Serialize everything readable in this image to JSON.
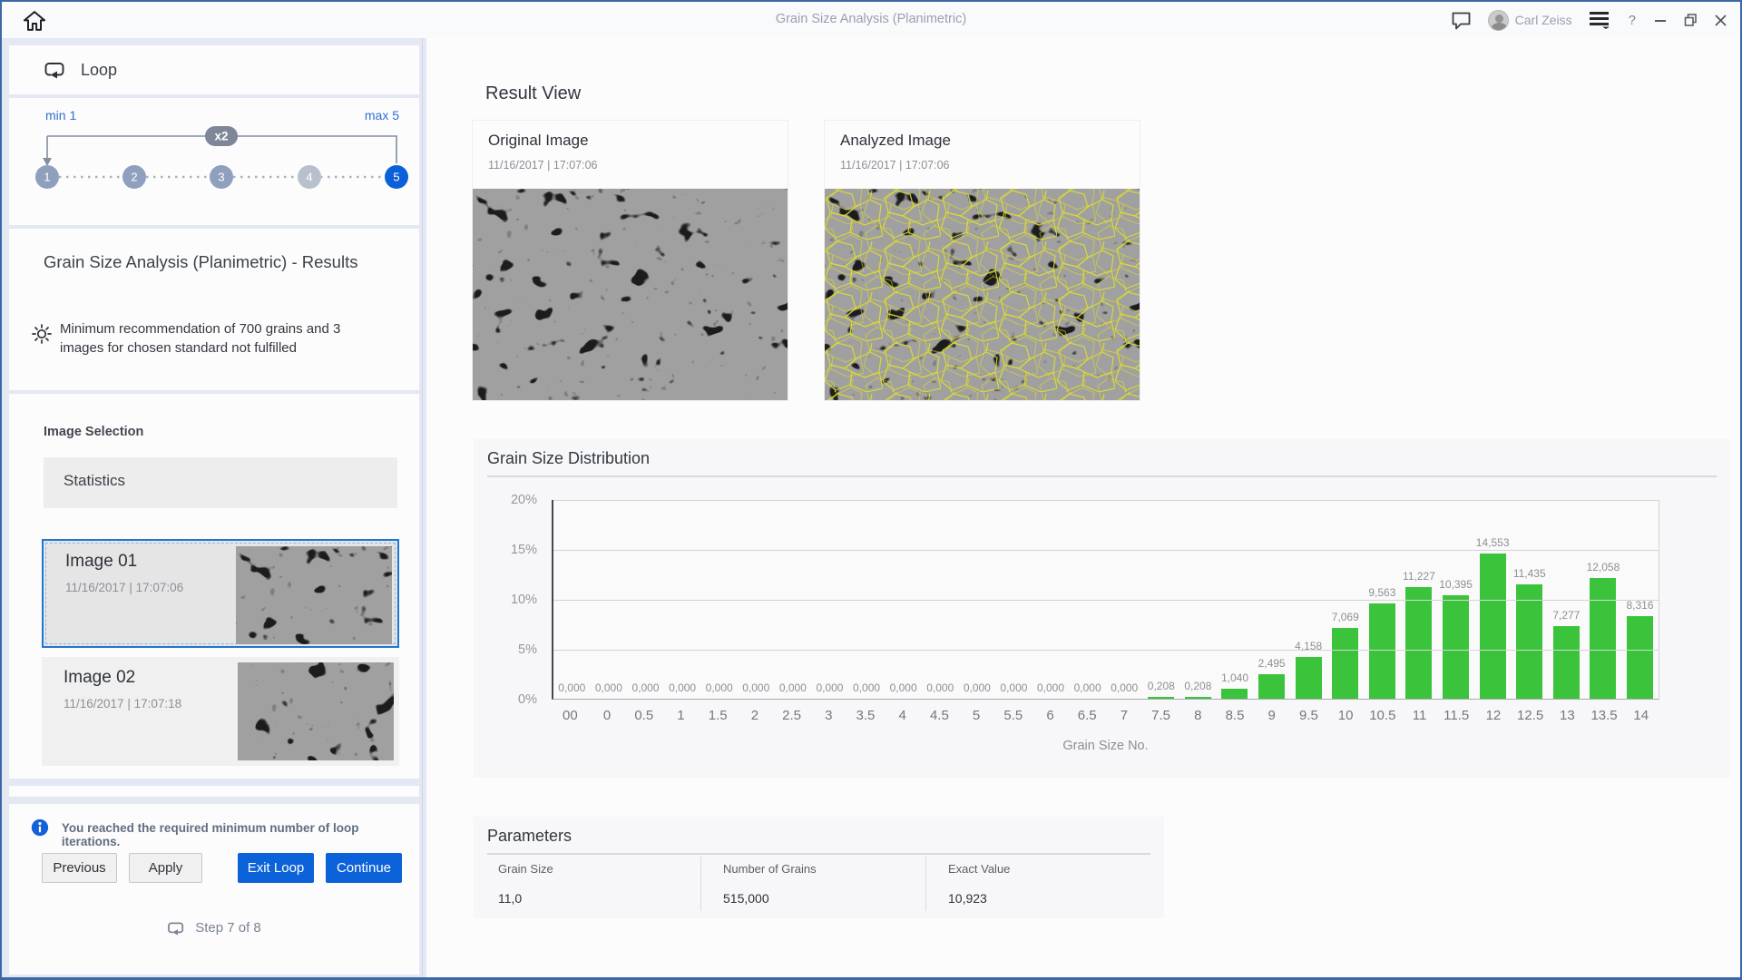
{
  "window": {
    "title": "Grain Size Analysis (Planimetric)",
    "user": "Carl Zeiss",
    "help_label": "?"
  },
  "sidebar": {
    "loop": {
      "label": "Loop",
      "min_label": "min 1",
      "max_label": "max 5",
      "multiplier": "x2",
      "steps": [
        {
          "label": "1",
          "state": "done"
        },
        {
          "label": "2",
          "state": "done"
        },
        {
          "label": "3",
          "state": "done"
        },
        {
          "label": "4",
          "state": "pending"
        },
        {
          "label": "5",
          "state": "active"
        }
      ]
    },
    "results_title": "Grain Size Analysis (Planimetric) - Results",
    "warning": "Minimum recommendation of 700 grains and 3 images for chosen standard not fulfilled",
    "image_selection": {
      "label": "Image Selection",
      "statistics_label": "Statistics",
      "items": [
        {
          "name": "Image 01",
          "timestamp": "11/16/2017 | 17:07:06",
          "selected": true
        },
        {
          "name": "Image 02",
          "timestamp": "11/16/2017 | 17:07:18",
          "selected": false
        }
      ]
    },
    "info_message": "You reached the required minimum number of loop iterations.",
    "buttons": {
      "previous": "Previous",
      "apply": "Apply",
      "exit_loop": "Exit Loop",
      "continue": "Continue"
    },
    "step_indicator": "Step 7 of 8"
  },
  "main": {
    "title": "Result View",
    "original_image": {
      "title": "Original Image",
      "timestamp": "11/16/2017 | 17:07:06"
    },
    "analyzed_image": {
      "title": "Analyzed Image",
      "timestamp": "11/16/2017 | 17:07:06"
    },
    "chart_title": "Grain Size Distribution",
    "parameters": {
      "title": "Parameters",
      "columns": [
        {
          "label": "Grain Size",
          "value": "11,0"
        },
        {
          "label": "Number of Grains",
          "value": "515,000"
        },
        {
          "label": "Exact Value",
          "value": "10,923"
        }
      ]
    }
  },
  "chart_data": {
    "type": "bar",
    "title": "Grain Size Distribution",
    "xlabel": "Grain Size No.",
    "ylabel": "",
    "ylim": [
      0,
      20
    ],
    "y_ticks": [
      "20%",
      "15%",
      "10%",
      "5%",
      "0%"
    ],
    "grid": "horizontal",
    "legend": "none",
    "bar_color": "#3bc43b",
    "categories": [
      "00",
      "0",
      "0.5",
      "1",
      "1.5",
      "2",
      "2.5",
      "3",
      "3.5",
      "4",
      "4.5",
      "5",
      "5.5",
      "6",
      "6.5",
      "7",
      "7.5",
      "8",
      "8.5",
      "9",
      "9.5",
      "10",
      "10.5",
      "11",
      "11.5",
      "12",
      "12.5",
      "13",
      "13.5",
      "14"
    ],
    "values": [
      0,
      0,
      0,
      0,
      0,
      0,
      0,
      0,
      0,
      0,
      0,
      0,
      0,
      0,
      0,
      0,
      0.208,
      0.208,
      1.04,
      2.495,
      4.158,
      7.069,
      9.563,
      11.227,
      10.395,
      14.553,
      11.435,
      7.277,
      12.058,
      8.316
    ],
    "value_labels": [
      "0,000",
      "0,000",
      "0,000",
      "0,000",
      "0,000",
      "0,000",
      "0,000",
      "0,000",
      "0,000",
      "0,000",
      "0,000",
      "0,000",
      "0,000",
      "0,000",
      "0,000",
      "0,000",
      "0,208",
      "0,208",
      "1,040",
      "2,495",
      "4,158",
      "7,069",
      "9,563",
      "11,227",
      "10,395",
      "14,553",
      "11,435",
      "7,277",
      "12,058",
      "8,316"
    ]
  },
  "colors": {
    "accent_blue": "#0c62d9",
    "bar_green": "#3bc43b",
    "selection_border": "#2176cf",
    "boundary_yellow": "#dede2a",
    "window_border": "#3c68a8"
  }
}
